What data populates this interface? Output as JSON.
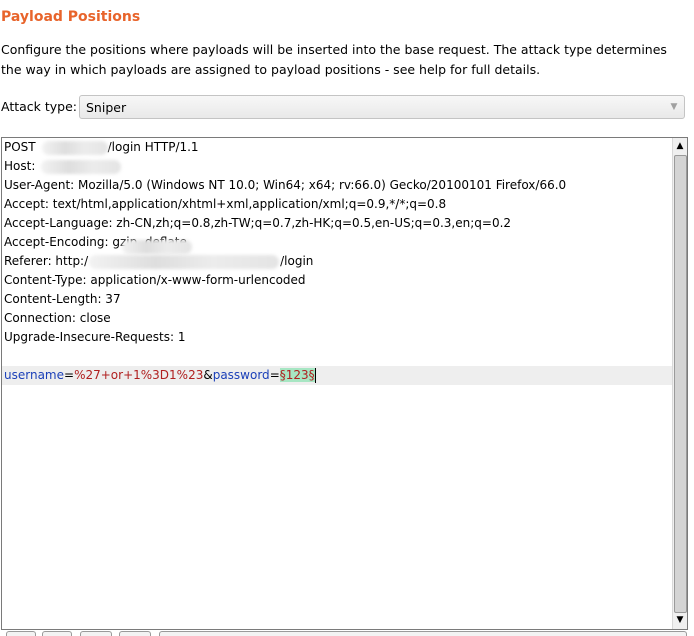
{
  "section": {
    "title": "Payload Positions",
    "description": "Configure the positions where payloads will be inserted into the base request. The attack type determines the way in which payloads are assigned to payload positions - see help for full details."
  },
  "attack_type": {
    "label": "Attack type:",
    "value": "Sniper",
    "arrow_icon": "chevron-down-icon"
  },
  "request": {
    "line1": {
      "method": "POST",
      "rest": "/login HTTP/1.1"
    },
    "line2": {
      "text": "Host:"
    },
    "line3": "User-Agent: Mozilla/5.0 (Windows NT 10.0; Win64; x64; rv:66.0) Gecko/20100101 Firefox/66.0",
    "line4": "Accept: text/html,application/xhtml+xml,application/xml;q=0.9,*/*;q=0.8",
    "line5": "Accept-Language: zh-CN,zh;q=0.8,zh-TW;q=0.7,zh-HK;q=0.5,en-US;q=0.3,en;q=0.2",
    "line6": "Accept-Encoding: gzip, deflate",
    "line7": {
      "prefix": "Referer: http:/",
      "suffix": "/login"
    },
    "line8": "Content-Type: application/x-www-form-urlencoded",
    "line9": "Content-Length: 37",
    "line10": "Connection: close",
    "line11": "Upgrade-Insecure-Requests: 1",
    "body": {
      "p1_name": "username",
      "p1_eq": "=",
      "p1_value": "%27+or+1%3D1%23",
      "amp": "&",
      "p2_name": "password",
      "p2_eq": "=",
      "p2_marker": "§123§"
    }
  },
  "scrollbar": {
    "up_icon": "arrow-up-icon",
    "down_icon": "arrow-down-icon"
  },
  "colors": {
    "title": "#e8642b",
    "param_name": "#1a3fb8",
    "param_value": "#b02020",
    "payload_marker_bg": "#a7e6c3"
  }
}
